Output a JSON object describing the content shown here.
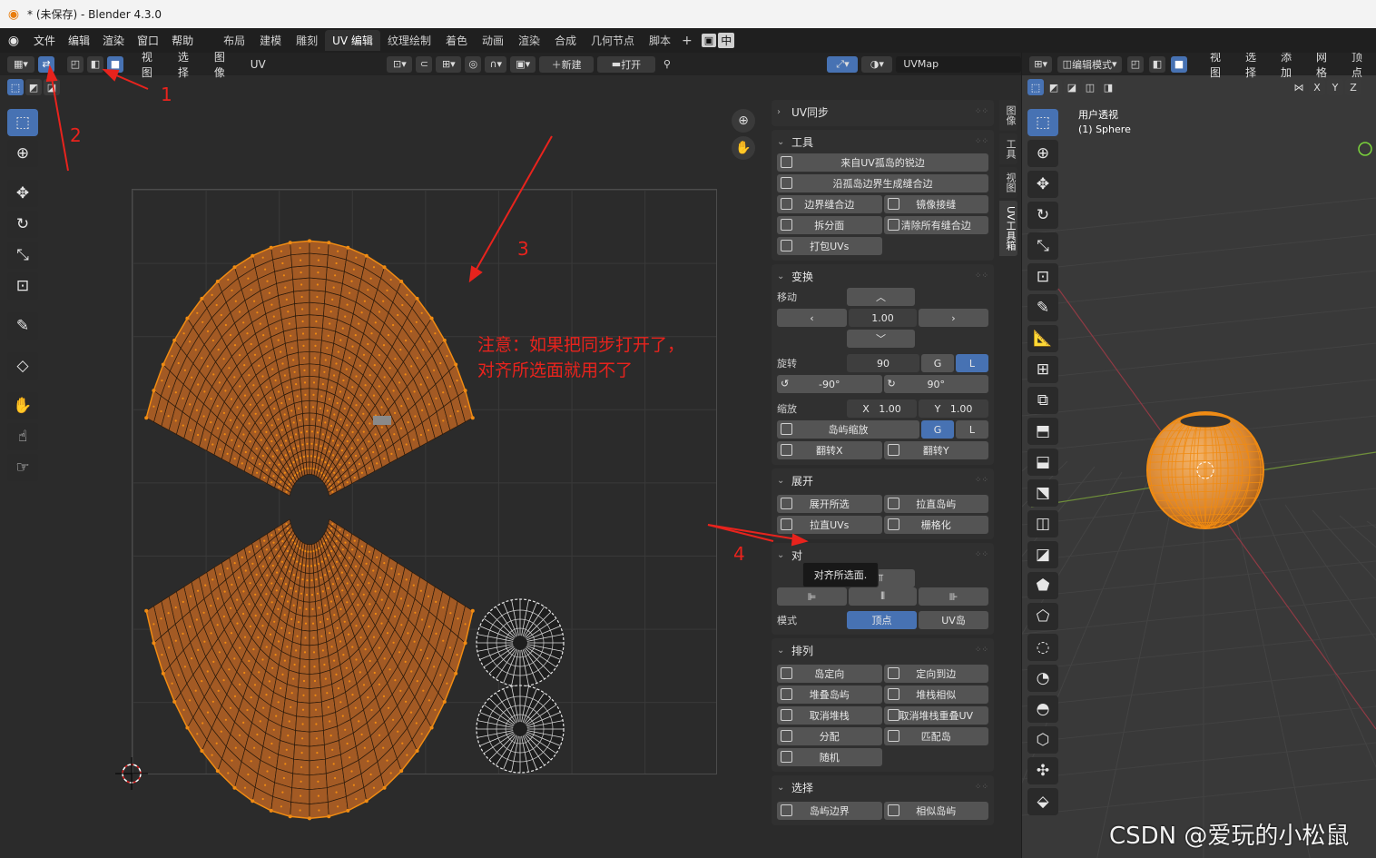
{
  "window": {
    "title": "* (未保存) - Blender 4.3.0"
  },
  "menu": [
    "文件",
    "编辑",
    "渲染",
    "窗口",
    "帮助"
  ],
  "workspaces": [
    {
      "label": "布局",
      "active": false
    },
    {
      "label": "建模",
      "active": false
    },
    {
      "label": "雕刻",
      "active": false
    },
    {
      "label": "UV 编辑",
      "active": true
    },
    {
      "label": "纹理绘制",
      "active": false
    },
    {
      "label": "着色",
      "active": false
    },
    {
      "label": "动画",
      "active": false
    },
    {
      "label": "渲染",
      "active": false
    },
    {
      "label": "合成",
      "active": false
    },
    {
      "label": "几何节点",
      "active": false
    },
    {
      "label": "脚本",
      "active": false
    }
  ],
  "workspace_add": "+",
  "ime_indicator": "中",
  "uv_header": {
    "menus": [
      "视图",
      "选择",
      "图像",
      "UV"
    ],
    "new_label": "新建",
    "open_label": "打开",
    "uvmap": "UVMap"
  },
  "npanel": {
    "uv_sync": "UV同步",
    "tools": {
      "title": "工具",
      "seams_from_islands": "来自UV孤岛的锐边",
      "seams_along_boundary": "沿孤岛边界生成缝合边",
      "boundary_seam": "边界缝合边",
      "mirror_seam": "镜像接缝",
      "split_faces": "拆分面",
      "clear_all_seams": "清除所有缝合边",
      "pack_uvs": "打包UVs"
    },
    "transform": {
      "title": "变换",
      "move_label": "移动",
      "move_value": "1.00",
      "rotate_label": "旋转",
      "rotate_value": "90",
      "g": "G",
      "l": "L",
      "rot_minus": "-90°",
      "rot_plus": "90°",
      "scale_label": "缩放",
      "scale_x_label": "X",
      "scale_x": "1.00",
      "scale_y_label": "Y",
      "scale_y": "1.00",
      "island_scale": "岛屿缩放",
      "flip_x": "翻转X",
      "flip_y": "翻转Y"
    },
    "unwrap": {
      "title": "展开",
      "unwrap_selected": "展开所选",
      "straighten_islands": "拉直岛屿",
      "straighten_uvs": "拉直UVs",
      "grid": "栅格化"
    },
    "align": {
      "title": "对",
      "tooltip": "对齐所选面.",
      "mode_label": "模式",
      "vertex": "顶点",
      "uv_island": "UV岛"
    },
    "arrange": {
      "title": "排列",
      "orient_island": "岛定向",
      "orient_edge": "定向到边",
      "stack_islands": "堆叠岛屿",
      "stack_similar": "堆栈相似",
      "unstack": "取消堆栈",
      "unstack_overlapped": "取消堆栈重叠UV",
      "distribute": "分配",
      "match_island": "匹配岛",
      "random": "随机"
    },
    "select": {
      "title": "选择",
      "island_borders": "岛屿边界",
      "similar_island": "相似岛屿"
    }
  },
  "vtabs": [
    "图像",
    "工具",
    "视图",
    "UV工具箱"
  ],
  "view3d": {
    "mode": "编辑模式",
    "menus": [
      "视图",
      "选择",
      "添加",
      "网格",
      "顶点"
    ],
    "axis": [
      "X",
      "Y",
      "Z"
    ],
    "overlay_title": "用户透视",
    "overlay_object": "(1) Sphere"
  },
  "annotations": {
    "n1": "1",
    "n2": "2",
    "n3": "3",
    "n4": "4",
    "note_line1": "注意：如果把同步打开了，",
    "note_line2": "对齐所选面就用不了"
  },
  "watermark": "CSDN @爱玩的小松鼠",
  "colors": {
    "accent": "#4772b3",
    "uv_face": "#a35a24",
    "uv_edge": "#f08b12",
    "annotation": "#e8231d"
  }
}
